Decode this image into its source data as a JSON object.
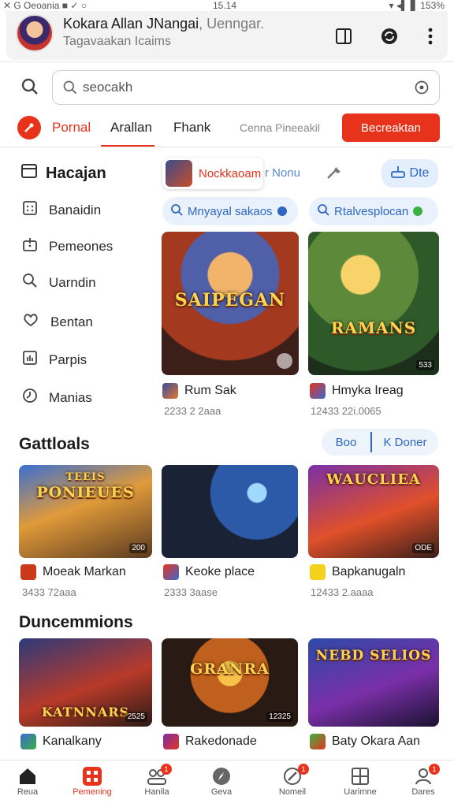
{
  "status": {
    "left": "✕ G Oeoania ■ ✓ ○",
    "time": "15.14",
    "battery": "▾ ◂▌ ▋ 153%"
  },
  "header": {
    "title": "Kokara Allan JNangai",
    "title_suffix": ", Uenngar.",
    "subtitle": "Tagavaakan Icaims",
    "icons": [
      "tablet-icon",
      "refresh-icon",
      "more-vert-icon"
    ]
  },
  "search": {
    "value": "seocakh",
    "placeholder": ""
  },
  "tabs": {
    "items": [
      "Pornal",
      "Arallan",
      "Fhank",
      "Cenna Pineeakil"
    ],
    "button": "Becreaktan",
    "active_index": 1
  },
  "sidebar": {
    "heading": "Hacajan",
    "items": [
      {
        "label": "Banaidin",
        "icon": "calendar-grid-icon"
      },
      {
        "label": "Pemeones",
        "icon": "gift-icon"
      },
      {
        "label": "Uarndin",
        "icon": "search-icon"
      },
      {
        "label": "Bentan",
        "icon": "heart-hand-icon"
      },
      {
        "label": "Parpis",
        "icon": "chart-icon"
      },
      {
        "label": "Manias",
        "icon": "clock-icon"
      }
    ]
  },
  "featured": {
    "chip_label": "Nockkaoam",
    "chip_more": "r Nonu",
    "dte_label": "Dte",
    "pills": [
      {
        "label": "Mnyayal sakaos",
        "dot_color": "#2e66c4"
      },
      {
        "label": "Rtalvesplocan",
        "dot_color": "#3cb043"
      }
    ],
    "games": [
      {
        "art_text": "SAIPEGAN",
        "art_sub": "",
        "title": "Rum Sak",
        "meta": "2233 2 2aaa"
      },
      {
        "art_text": "RAMANS",
        "art_sub": "",
        "title": "Hmyka Ireag",
        "meta": "12433 22i.0065",
        "badge": "533"
      }
    ]
  },
  "gattloals": {
    "title": "Gattloals",
    "seg_a": "Boo",
    "seg_b": "K Doner",
    "games": [
      {
        "art_text": "PONIEUES",
        "art_top": "TEEIS",
        "title": "Moeak Markan",
        "meta": "3433 72aaa",
        "badge": "200"
      },
      {
        "art_text": "",
        "title": "Keoke place",
        "meta": "2333 3aase"
      },
      {
        "art_text": "WAUCLIEA",
        "title": "Bapkanugaln",
        "meta": "12433 2.aaaa",
        "badge": "ODE"
      }
    ]
  },
  "duncemmions": {
    "title": "Duncemmions",
    "games": [
      {
        "art_text": "KATNNARS",
        "title": "Kanalkany",
        "badge": "2525"
      },
      {
        "art_text": "GRANRA",
        "title": "Rakedonade",
        "badge": "12325"
      },
      {
        "art_text": "NEBD SELIOS",
        "title": "Baty Okara Aan"
      }
    ]
  },
  "bottom_nav": [
    {
      "label": "Reua",
      "icon": "home-icon"
    },
    {
      "label": "Pemening",
      "icon": "grid-icon",
      "active": true
    },
    {
      "label": "Hanila",
      "icon": "people-icon",
      "badge": "1"
    },
    {
      "label": "Geva",
      "icon": "compass-icon"
    },
    {
      "label": "Nomeil",
      "icon": "tag-icon",
      "badge": "1"
    },
    {
      "label": "Uarimne",
      "icon": "apps-icon"
    },
    {
      "label": "Dares",
      "icon": "profile-icon",
      "badge": "1"
    }
  ],
  "colors": {
    "accent": "#e8331c",
    "link": "#2e66c4",
    "pill_bg": "#e8f1fc"
  }
}
